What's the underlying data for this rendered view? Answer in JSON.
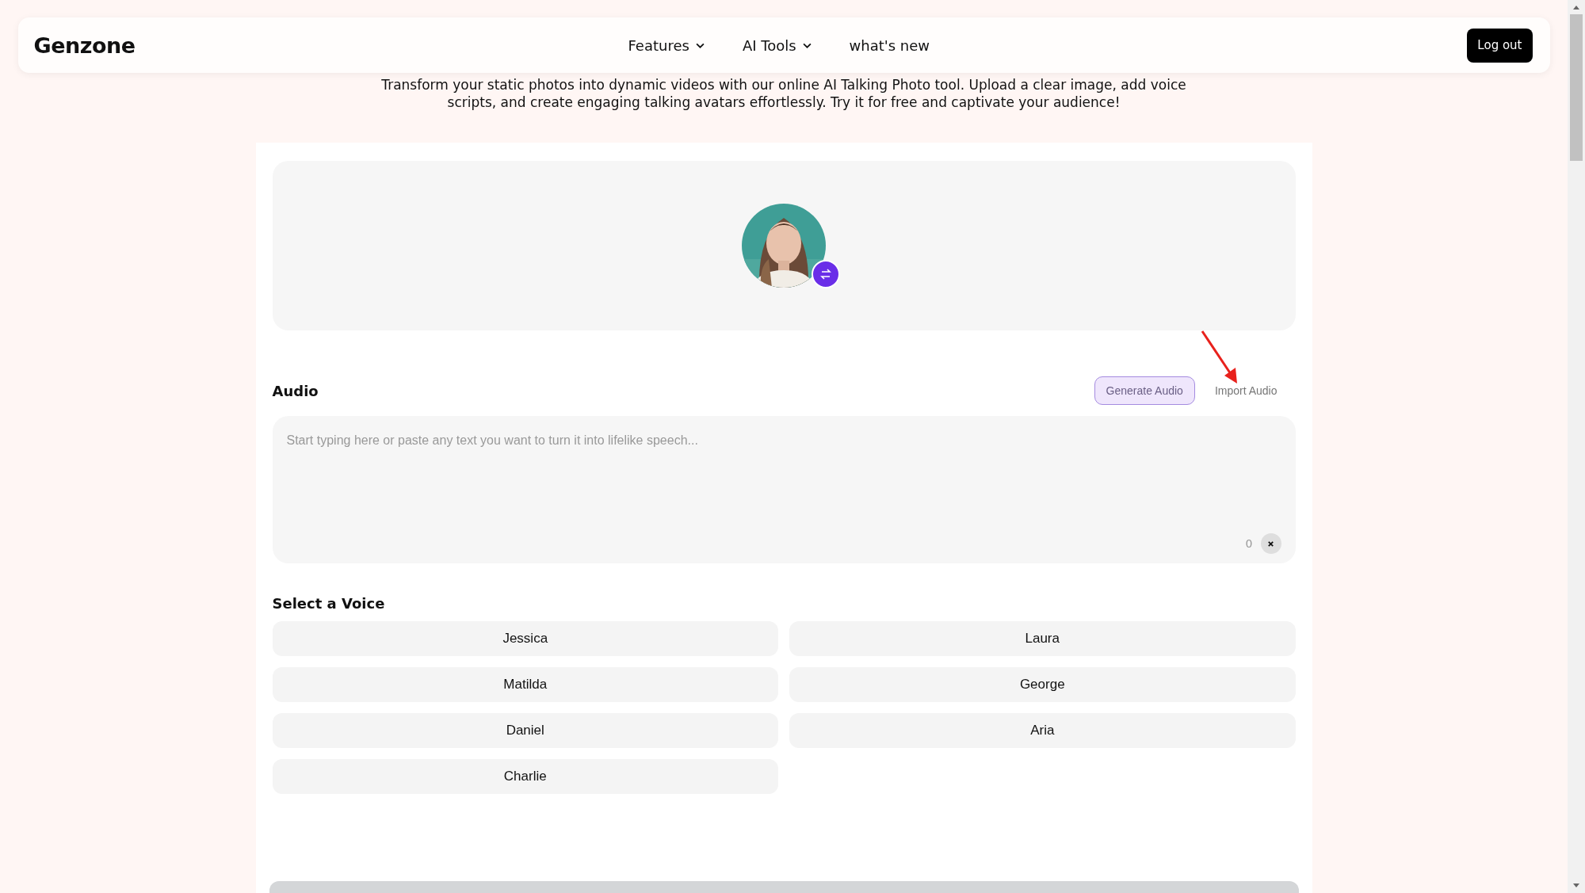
{
  "logo": "Genzone",
  "nav": [
    {
      "label": "Features",
      "dropdown": true
    },
    {
      "label": "AI Tools",
      "dropdown": true
    },
    {
      "label": "what's new",
      "dropdown": false
    }
  ],
  "logout_button": "Log out",
  "description": "Transform your static photos into dynamic videos with our online AI Talking Photo tool. Upload a clear image, add voice scripts, and create engaging talking avatars effortlessly. Try it for free and captivate your audience!",
  "audio": {
    "title": "Audio",
    "tabs": [
      {
        "label": "Generate Audio",
        "selected": true
      },
      {
        "label": "Import Audio",
        "selected": false
      }
    ],
    "text_input": {
      "placeholder": "Start typing here or paste any text you want to turn it into lifelike speech...",
      "count": "0"
    }
  },
  "voices": {
    "title": "Select a Voice",
    "items": [
      "Jessica",
      "Laura",
      "Matilda",
      "George",
      "Daniel",
      "Aria",
      "Charlie"
    ]
  }
}
